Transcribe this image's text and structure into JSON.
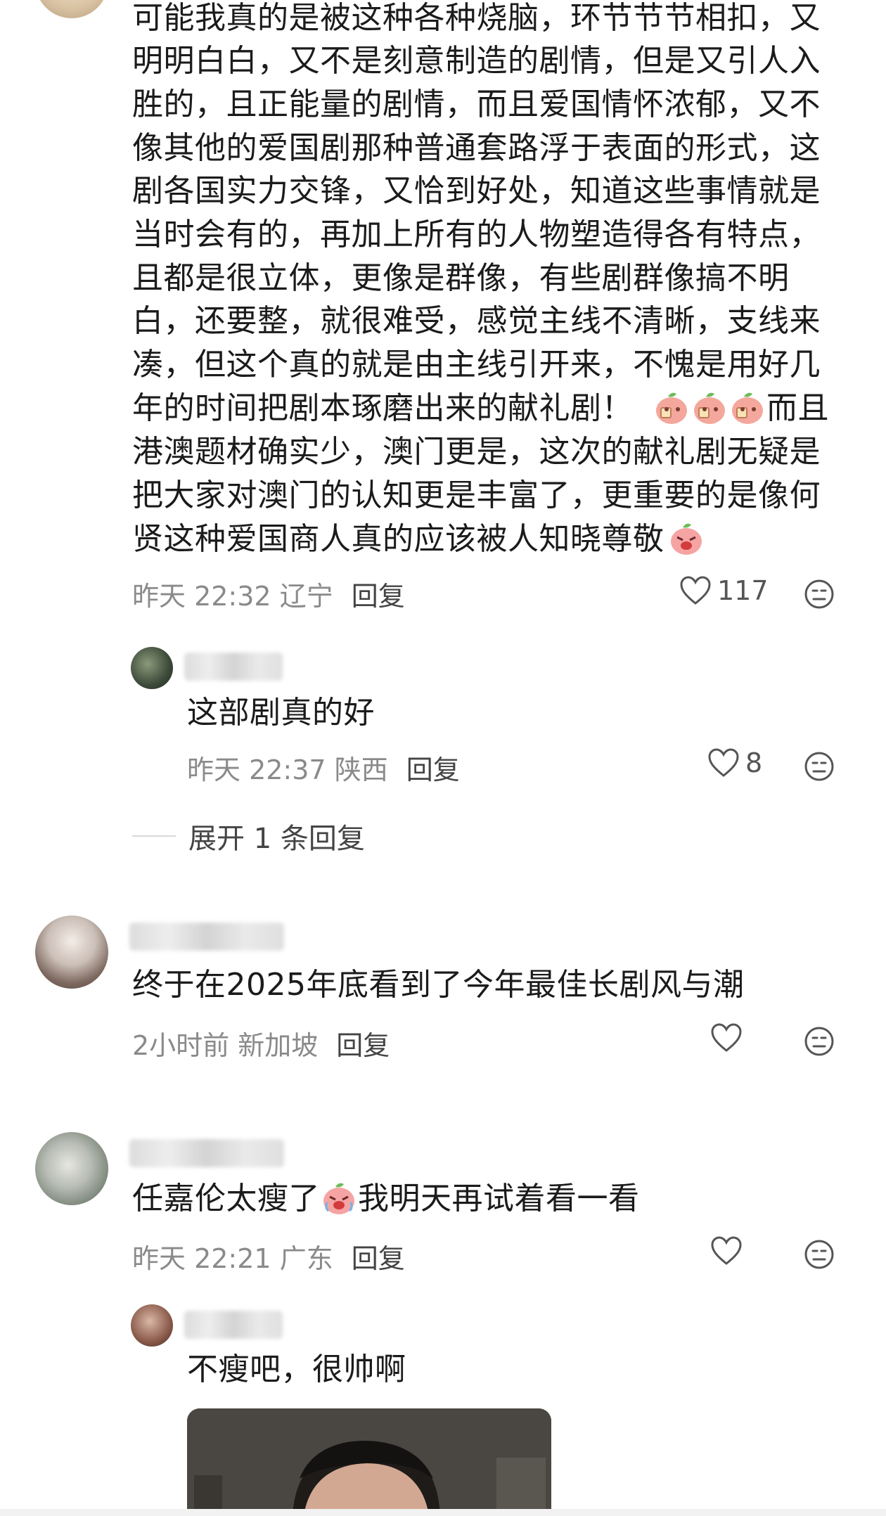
{
  "comments": [
    {
      "lines": [
        "可能我真的是被这种各种烧脑，环节节节相扣，又",
        "明明白白，又不是刻意制造的剧情，但是又引人入",
        "胜的，且正能量的剧情，而且爱国情怀浓郁，又不",
        "像其他的爱国剧那种普通套路浮于表面的形式，这",
        "剧各国实力交锋，又恰到好处，知道这些事情就是",
        "当时会有的，再加上所有的人物塑造得各有特点，",
        "且都是很立体，更像是群像，有些剧群像搞不明",
        "白，还要整，就很难受，感觉主线不清晰，支线来",
        "凑，但这个真的就是由主线引开来，不愧是用好几",
        "年的时间把剧本琢磨出来的献礼剧！",
        "而且",
        "港澳题材确实少，澳门更是，这次的献礼剧无疑是",
        "把大家对澳门的认知更是丰富了，更重要的是像何",
        "贤这种爱国商人真的应该被人知晓尊敬"
      ],
      "time": "昨天 22:32",
      "location": "辽宁",
      "reply_label": "回复",
      "likes": "117"
    },
    {
      "text": "这部剧真的好",
      "time": "昨天 22:37",
      "location": "陕西",
      "reply_label": "回复",
      "likes": "8"
    },
    {
      "expand_label": "展开 1 条回复"
    },
    {
      "text": "终于在2025年底看到了今年最佳长剧风与潮",
      "time": "2小时前",
      "location": "新加坡",
      "reply_label": "回复",
      "likes": ""
    },
    {
      "text_before": "任嘉伦太瘦了",
      "text_after": "我明天再试着看一看",
      "time": "昨天 22:21",
      "location": "广东",
      "reply_label": "回复",
      "likes": ""
    },
    {
      "text": "不瘦吧，很帅啊"
    }
  ],
  "icons": [
    "heart-icon",
    "dislike-face-icon",
    "peach-emoji",
    "crying-peach-emoji"
  ],
  "colors": {
    "meta": "#8a8a8a",
    "text": "#1b1b1b",
    "background": "#ffffff"
  }
}
